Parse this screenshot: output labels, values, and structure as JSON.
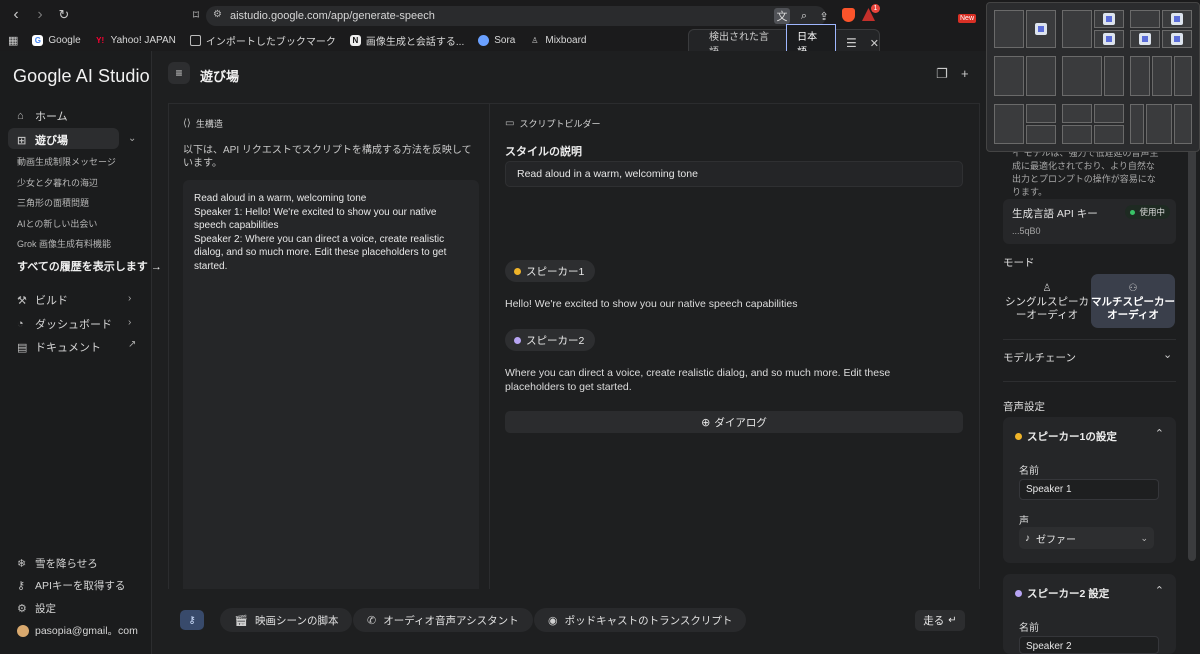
{
  "browser": {
    "url": "aistudio.google.com/app/generate-speech",
    "bookmarks": [
      {
        "label": "Google",
        "color": "#4285f4",
        "glyph": "G"
      },
      {
        "label": "Yahoo! JAPAN",
        "color": "#ff0033",
        "glyph": "Y"
      },
      {
        "label": "インポートしたブックマーク",
        "color": "#888888",
        "glyph": "▭"
      },
      {
        "label": "画像生成と会話する...",
        "color": "#dddddd",
        "glyph": "n"
      },
      {
        "label": "Sora",
        "color": "#6aa0ff",
        "glyph": "◎"
      },
      {
        "label": "Mixboard",
        "color": "#bbbbbb",
        "glyph": "♟"
      }
    ],
    "ext_badge": "1",
    "new_badge": "New"
  },
  "translate": {
    "detected_label": "検出された言語",
    "language": "日本語"
  },
  "sidebar": {
    "logo": "Google AI Studio",
    "home": "ホーム",
    "playground": "遊び場",
    "history": [
      "動画生成制限メッセージ",
      "少女と夕暮れの海辺",
      "三角形の面積問題",
      "AIとの新しい出会い",
      "Grok 画像生成有料機能"
    ],
    "show_all_history": "すべての履歴を表示します →",
    "build": "ビルド",
    "dashboard": "ダッシュボード",
    "docs": "ドキュメント",
    "snow": "雪を降らせろ",
    "get_api_key": "APIキーを取得する",
    "settings": "設定",
    "account": "pasopia@gmail。com"
  },
  "header": {
    "title": "遊び場"
  },
  "raw_structure": {
    "label": "生構造",
    "description": "以下は、API リクエストでスクリプトを構成する方法を反映しています。",
    "code": [
      "Read aloud in a warm, welcoming tone",
      "Speaker 1: Hello! We're excited to show you our native",
      "speech capabilities",
      "Speaker 2: Where you can direct a voice, create realistic",
      "dialog, and so much more. Edit these placeholders to get",
      "started."
    ]
  },
  "script_builder": {
    "label": "スクリプトビルダー",
    "style_heading": "スタイルの説明",
    "style_value": "Read aloud in a warm, welcoming tone",
    "speakers": [
      {
        "name": "スピーカー1",
        "color": "#f0b429",
        "text": "Hello! We're excited to show you our native speech capabilities"
      },
      {
        "name": "スピーカー2",
        "color": "#b7a4f3",
        "text": "Where you can direct a voice, create realistic dialog, and so much more. Edit these placeholders to get started."
      }
    ],
    "add_dialog": "ダイアログ"
  },
  "bottom_bar": {
    "chips": [
      "映画シーンの脚本",
      "オーディオ音声アシスタント",
      "ポッドキャストのトランスクリプト"
    ],
    "run": "走る"
  },
  "run_settings": {
    "note": "イ モデルは、強力で低遅延の音声生成に最適化されており、より自然な出力とプロンプトの操作が容易になります。",
    "api_key_title": "生成言語 API キー",
    "api_status": "使用中",
    "api_key_suffix": "...5qB0",
    "mode_heading": "モード",
    "mode_single": "シングルスピーカーオーディオ",
    "mode_multi": "マルチスピーカーオーディオ",
    "model_chain": "モデルチェーン",
    "voice_settings": "音声設定",
    "speaker1_settings": "スピーカー1の設定",
    "speaker2_settings": "スピーカー2 設定",
    "name_label": "名前",
    "voice_label": "声",
    "speaker1_name": "Speaker 1",
    "speaker1_voice": "ゼファー",
    "speaker2_name": "Speaker 2"
  }
}
